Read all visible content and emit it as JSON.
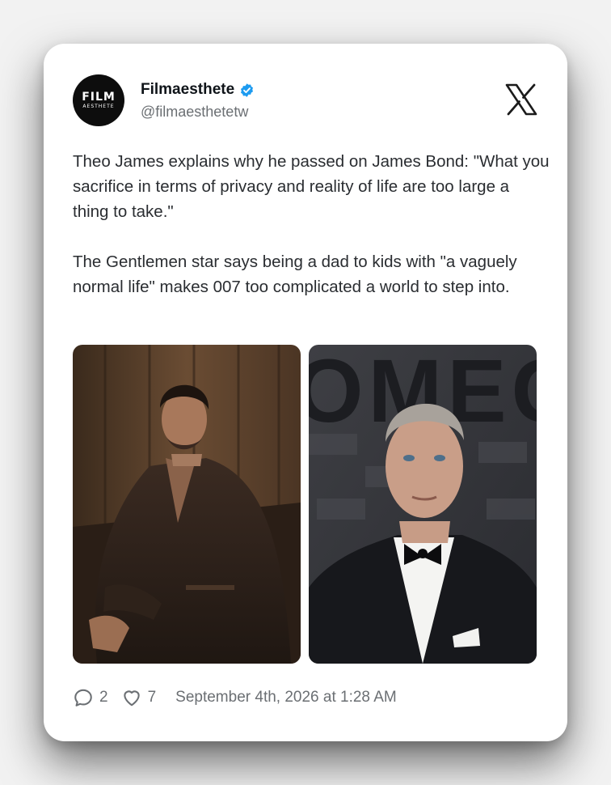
{
  "author": {
    "display_name": "Filmaesthete",
    "handle": "@filmaesthetetw",
    "avatar_text_big": "FILM",
    "avatar_text_small": "AESTHETE",
    "verified": true
  },
  "brand_icon": "x-logo-icon",
  "tweet": {
    "paragraph_1": "Theo James explains why he passed on James Bond: \"What you sacrifice in terms of privacy and reality of life are too large a thing to take.\"",
    "paragraph_2": "The Gentlemen star says being a dad to kids with \"a vaguely normal life\" makes 007 too complicated a world to step into.",
    "images": [
      {
        "icon": "photo-man-in-dark-robe"
      },
      {
        "icon": "photo-man-in-tuxedo",
        "background_text": "OMEGA"
      }
    ]
  },
  "stats": {
    "replies": "2",
    "likes": "7",
    "timestamp": "September 4th, 2026 at 1:28 AM"
  },
  "colors": {
    "verified_badge": "#1d9bf0",
    "text": "#2a2d31",
    "muted": "#6b6f73"
  }
}
